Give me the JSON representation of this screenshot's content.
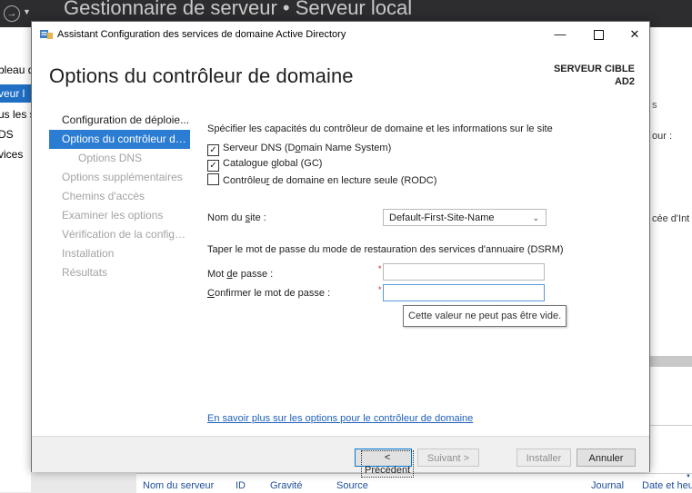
{
  "background": {
    "title": "Gestionnaire de serveur • Serveur local",
    "nav_items": [
      "bleau d",
      "veur l",
      "us les s",
      "DS",
      "vices"
    ],
    "right_fragment_1": "our :",
    "right_fragment_2": "cée d'Int",
    "right_tick": "s",
    "columns": [
      "Nom du serveur",
      "ID",
      "Gravité",
      "Source",
      "Journal",
      "Date et heu"
    ]
  },
  "dialog": {
    "title": "Assistant Configuration des services de domaine Active Directory",
    "page_title": "Options du contrôleur de domaine",
    "target_label": "SERVEUR CIBLE",
    "target_name": "AD2"
  },
  "sidebar": {
    "steps": [
      {
        "label": "Configuration de déploie..."
      },
      {
        "label": "Options du contrôleur de..."
      },
      {
        "label": "Options DNS"
      },
      {
        "label": "Options supplémentaires"
      },
      {
        "label": "Chemins d'accès"
      },
      {
        "label": "Examiner les options"
      },
      {
        "label": "Vérification de la configur..."
      },
      {
        "label": "Installation"
      },
      {
        "label": "Résultats"
      }
    ]
  },
  "content": {
    "section1_title": "Spécifier les capacités du contrôleur de domaine et les informations sur le site",
    "checkboxes": [
      {
        "label_pre": "Serveur DNS (D",
        "label_u": "o",
        "label_post": "main Name System)",
        "checked": true
      },
      {
        "label_pre": "Catalogue ",
        "label_u": "g",
        "label_post": "lobal (GC)",
        "checked": true
      },
      {
        "label_pre": "Contrôleu",
        "label_u": "r",
        "label_post": " de domaine en lecture seule (RODC)",
        "checked": false
      }
    ],
    "site_label_pre": "Nom du ",
    "site_label_u": "s",
    "site_label_post": "ite :",
    "site_value": "Default-First-Site-Name",
    "section2_title": "Taper le mot de passe du mode de restauration des services d'annuaire (DSRM)",
    "password_label_pre": "Mot ",
    "password_label_u": "d",
    "password_label_post": "e passe :",
    "confirm_label_pre": "",
    "confirm_label_u": "C",
    "confirm_label_post": "onfirmer le mot de passe :",
    "required_mark": "*",
    "password_value": "",
    "confirm_value": "",
    "tooltip": "Cette valeur ne peut pas être vide.",
    "learn_more": "En savoir plus sur les options pour le contrôleur de domaine"
  },
  "footer": {
    "prev": "< Précédent",
    "next": "Suivant >",
    "install": "Installer",
    "cancel": "Annuler"
  },
  "window_controls": {
    "minimize": "—",
    "close": "✕"
  },
  "colors": {
    "accent": "#2b7cd3",
    "link": "#1f5fb8",
    "required": "#c42020"
  }
}
